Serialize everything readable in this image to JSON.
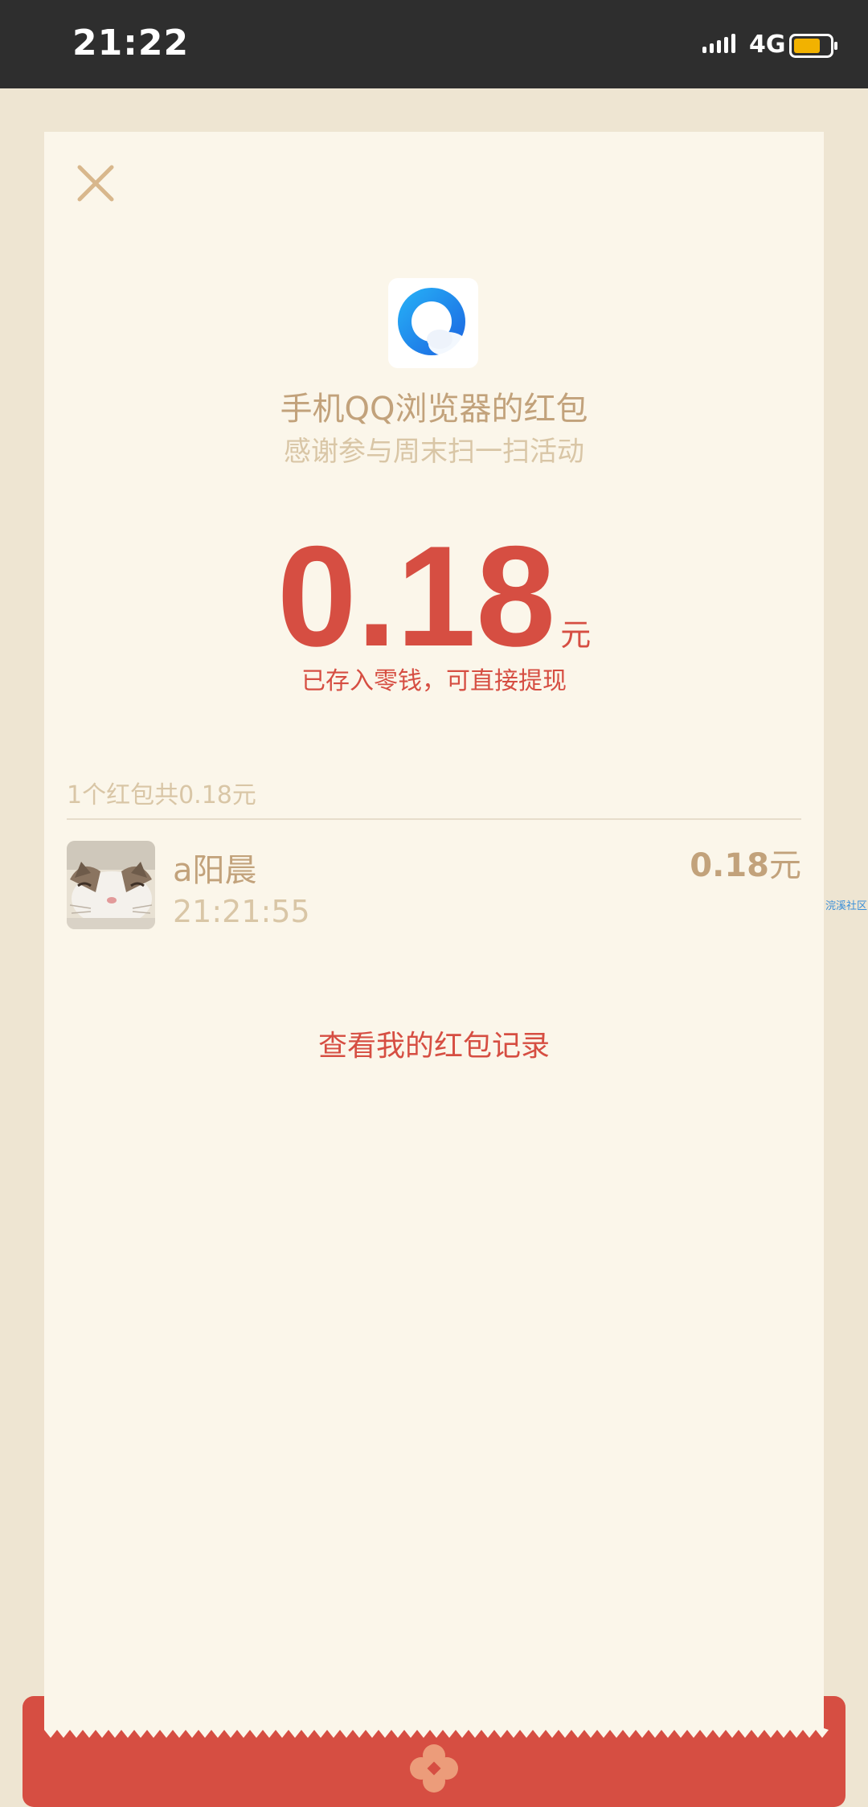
{
  "status_bar": {
    "time": "21:22",
    "network": "4G",
    "icons": [
      "signal-icon",
      "battery-icon"
    ]
  },
  "red_packet": {
    "close_icon": "close-icon",
    "app_logo": "qq-browser-logo",
    "sender_title": "手机QQ浏览器的红包",
    "greeting": "感谢参与周末扫一扫活动",
    "amount": "0.18",
    "unit": "元",
    "note": "已存入零钱，可直接提现",
    "summary": "1个红包共0.18元",
    "receiver": {
      "name": "a阳晨",
      "time": "21:21:55",
      "amount": "0.18",
      "unit": "元"
    },
    "records_link": "查看我的红包记录"
  },
  "side_label": "浣溪社区",
  "colors": {
    "accent_red": "#D64E42",
    "gold": "#C2A27B",
    "pale_gold": "#D9C6A6",
    "card_bg": "#FBF6EA",
    "page_bg": "#EEE5D2",
    "status_bg": "#2E2E2E"
  }
}
